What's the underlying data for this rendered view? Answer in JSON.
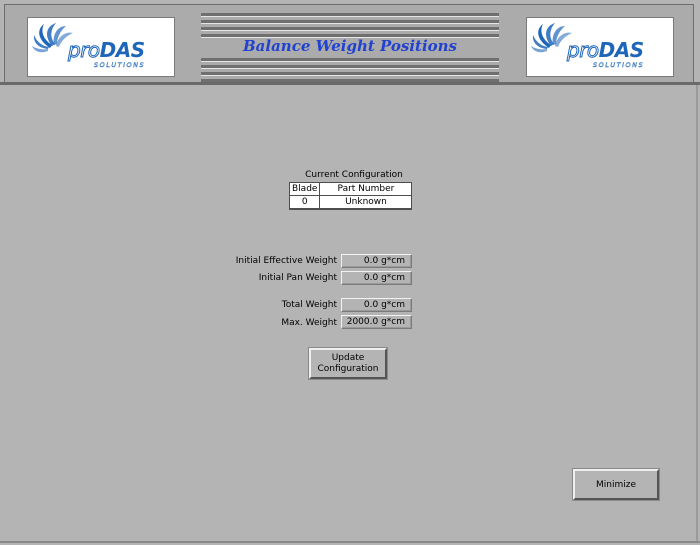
{
  "header": {
    "title": "Balance Weight Positions",
    "logo": {
      "word_pro": "pro",
      "word_das": "DAS",
      "tagline": "SOLUTIONS",
      "color": "#1e66b9"
    }
  },
  "configuration": {
    "caption": "Current Configuration",
    "columns": [
      "Blade",
      "Part Number"
    ],
    "rows": [
      {
        "blade": "0",
        "part_number": "Unknown"
      }
    ]
  },
  "weights": {
    "initial_effective": {
      "label": "Initial Effective Weight",
      "value": "0.0  g*cm"
    },
    "initial_pan": {
      "label": "Initial Pan Weight",
      "value": "0.0  g*cm"
    },
    "total": {
      "label": "Total Weight",
      "value": "0.0  g*cm"
    },
    "max": {
      "label": "Max. Weight",
      "value": "2000.0  g*cm"
    }
  },
  "buttons": {
    "update_line1": "Update",
    "update_line2": "Configuration",
    "minimize": "Minimize"
  },
  "colors": {
    "background": "#b4b4b4",
    "title": "#2142ce"
  }
}
